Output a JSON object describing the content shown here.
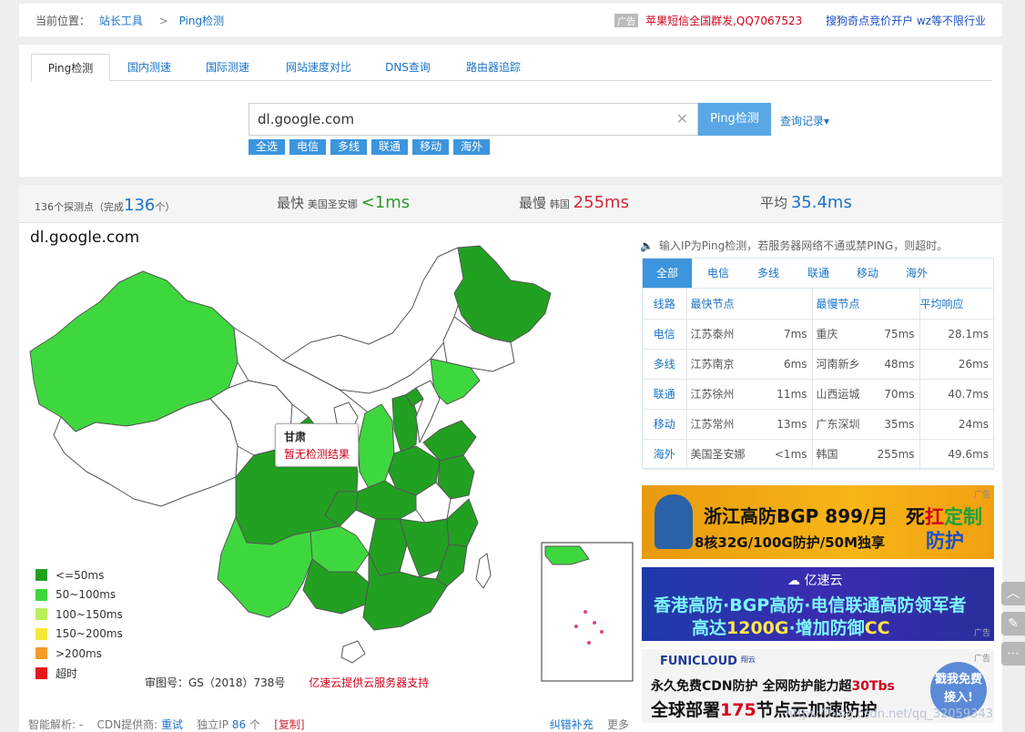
{
  "breadcrumb": {
    "prefix": "当前位置：",
    "items": [
      "站长工具",
      "Ping检测"
    ],
    "sep": ">"
  },
  "top_ads": {
    "tag": "广告",
    "ad1": "苹果短信全国群发,QQ7067523",
    "ad2": "搜狗奇点竞价开户 wz等不限行业"
  },
  "tabs": [
    "Ping检测",
    "国内测速",
    "国际测速",
    "网站速度对比",
    "DNS查询",
    "路由器追踪"
  ],
  "search": {
    "value": "dl.google.com",
    "button": "Ping检测",
    "history": "查询记录▾",
    "clear": "✕"
  },
  "filters": [
    "全选",
    "电信",
    "多线",
    "联通",
    "移动",
    "海外"
  ],
  "summary": {
    "count_label": "136个探测点（完成",
    "count": "136",
    "count_suffix": "个）",
    "fastest_label": "最快",
    "fastest_loc": "美国圣安娜",
    "fastest_val": "<1ms",
    "slowest_label": "最慢",
    "slowest_loc": "韩国",
    "slowest_val": "255ms",
    "avg_label": "平均",
    "avg_val": "35.4ms"
  },
  "map": {
    "title": "dl.google.com",
    "tooltip_title": "甘肃",
    "tooltip_text": "暂无检测结果",
    "legend": [
      {
        "label": "<=50ms",
        "color": "#22a022"
      },
      {
        "label": "50~100ms",
        "color": "#3ed83e"
      },
      {
        "label": "100~150ms",
        "color": "#b9f05a"
      },
      {
        "label": "150~200ms",
        "color": "#f5e83a"
      },
      {
        "label": ">200ms",
        "color": "#f39c2c"
      },
      {
        "label": "超时",
        "color": "#e31818"
      }
    ],
    "license": "审图号：GS（2018）738号",
    "sponsor": "亿速云提供云服务器支持"
  },
  "notice": "输入IP为Ping检测，若服务器网络不通或禁PING，则超时。",
  "isp_tabs": [
    "全部",
    "电信",
    "多线",
    "联通",
    "移动",
    "海外"
  ],
  "isp_table": {
    "headers": [
      "线路",
      "最快节点",
      "最慢节点",
      "平均响应"
    ],
    "rows": [
      {
        "line": "电信",
        "fast_node": "江苏泰州",
        "fast_ms": "7ms",
        "slow_node": "重庆",
        "slow_ms": "75ms",
        "avg": "28.1ms"
      },
      {
        "line": "多线",
        "fast_node": "江苏南京",
        "fast_ms": "6ms",
        "slow_node": "河南新乡",
        "slow_ms": "48ms",
        "avg": "26ms"
      },
      {
        "line": "联通",
        "fast_node": "江苏徐州",
        "fast_ms": "11ms",
        "slow_node": "山西运城",
        "slow_ms": "70ms",
        "avg": "40.7ms"
      },
      {
        "line": "移动",
        "fast_node": "江苏常州",
        "fast_ms": "13ms",
        "slow_node": "广东深圳",
        "slow_ms": "35ms",
        "avg": "24ms"
      },
      {
        "line": "海外",
        "fast_node": "美国圣安娜",
        "fast_ms": "<1ms",
        "slow_node": "韩国",
        "slow_ms": "255ms",
        "avg": "49.6ms"
      }
    ]
  },
  "ads": {
    "corner": "广告",
    "ad1": {
      "line1": "浙江高防BGP 899/月",
      "line2": "8核32G/100G防护/50M独享",
      "line3a": "死",
      "line3b": "扛",
      "line3c": "定制",
      "line3d": "防护"
    },
    "ad2": {
      "logo": "亿速云",
      "line1": "香港高防·BGP高防·电信联通高防领军者",
      "line2a": "高达",
      "line2b": "1200G",
      "line2c": "·增加防御",
      "line2d": "CC"
    },
    "ad3": {
      "logo": "FUNICLOUD",
      "logo_sub": "翔云",
      "line1a": "永久免费CDN防护  全网防护能力超",
      "line1b": "30Tbs",
      "line2a": "全球部署",
      "line2b": "175",
      "line2c": "节点云加速防护",
      "cta": "戳我免费接入!"
    }
  },
  "watermark": "https://blog.csdn.net/qq_32059343",
  "bottom": {
    "label1": "智能解析: -",
    "label2": "CDN提供商:",
    "retry": "重试",
    "label3": "独立IP",
    "ip_count": "86",
    "label4": "个",
    "copy": "[复制]",
    "report": "纠错补充",
    "more": "更多"
  }
}
